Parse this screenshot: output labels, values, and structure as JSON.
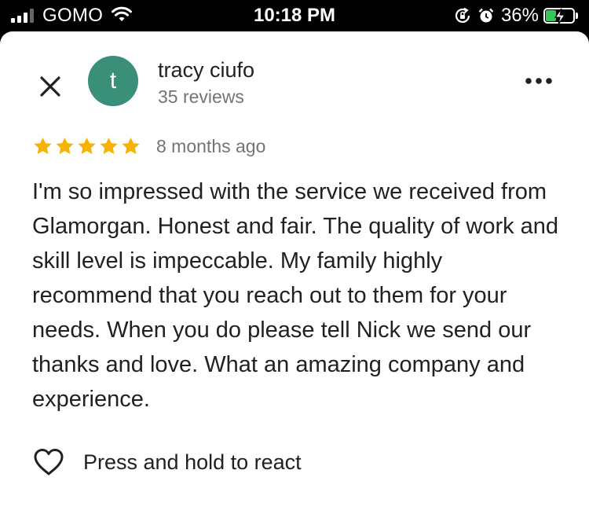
{
  "status_bar": {
    "carrier": "GOMO",
    "time": "10:18 PM",
    "battery_percent": "36%",
    "battery_level": 0.36,
    "icons": [
      "signal-icon",
      "wifi-icon",
      "rotation-lock-icon",
      "alarm-icon",
      "battery-charging-icon"
    ]
  },
  "review": {
    "author_initial": "t",
    "author_name": "tracy ciufo",
    "author_reviews": "35 reviews",
    "rating": 5,
    "time_ago": "8 months ago",
    "text": "I'm so impressed with the service we received from Glamorgan. Honest and fair. The quality of work and skill level is impeccable. My family highly recommend that you reach out to them for your needs. When you do please tell Nick we send our thanks and love. What an amazing company and experience.",
    "react_label": "Press and hold to react",
    "icons": [
      "close-icon",
      "more-vert-icon",
      "star-icon",
      "heart-outline-icon"
    ]
  },
  "colors": {
    "avatar_bg": "#3a8f79",
    "star": "#f4b400",
    "secondary_text": "#70757a",
    "primary_text": "#202124",
    "battery_charging": "#35c759"
  }
}
